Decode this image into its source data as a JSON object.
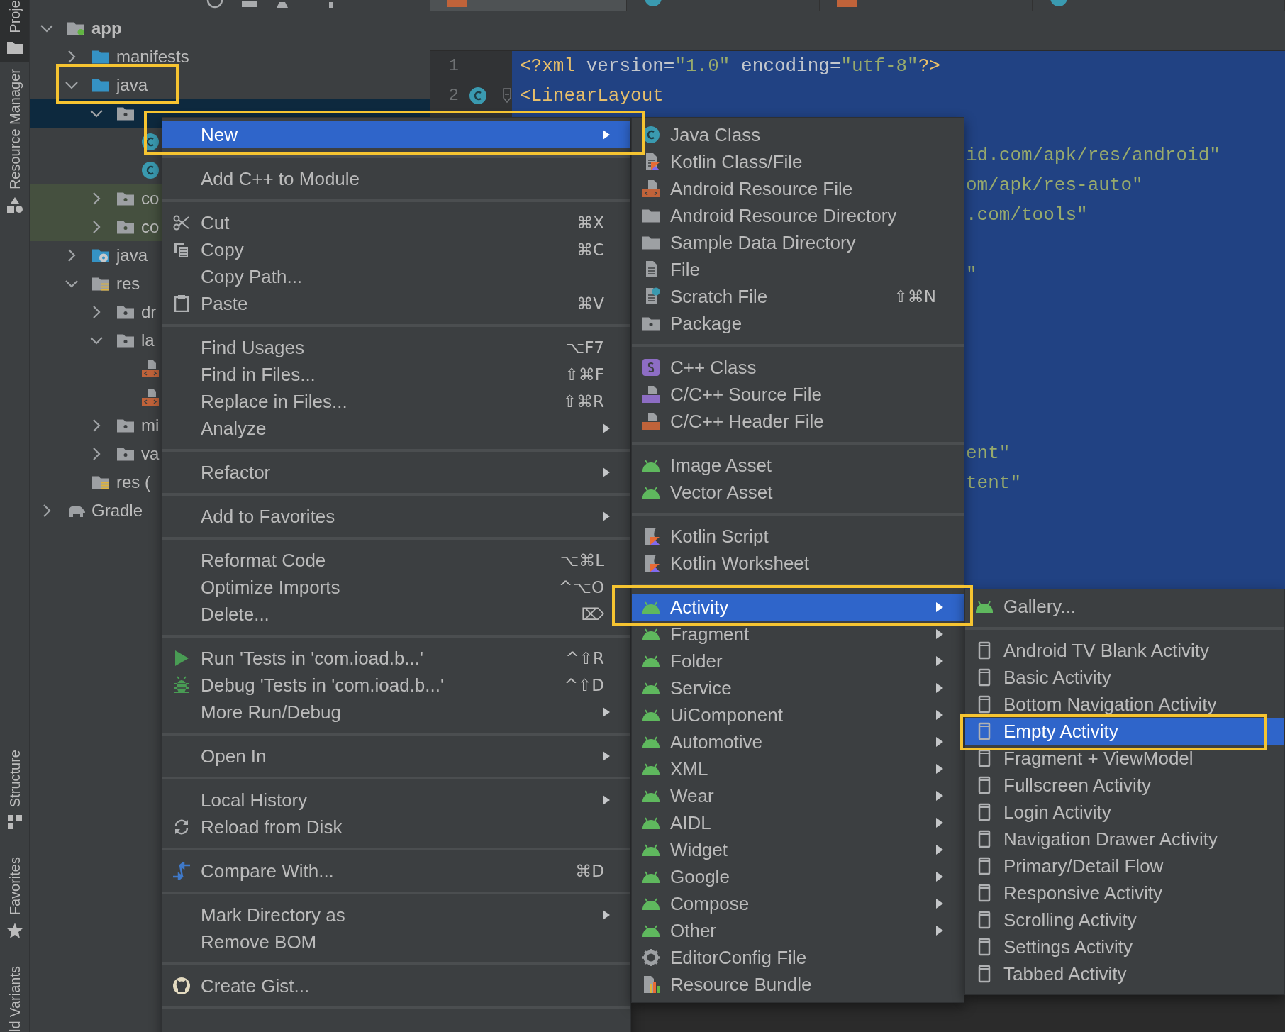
{
  "tool_strip": {
    "top": [
      {
        "label": "Proje",
        "selected": true
      },
      {
        "label": "Resource Manager",
        "selected": false
      }
    ],
    "bottom": [
      {
        "label": "Structure",
        "selected": false
      },
      {
        "label": "Favorites",
        "selected": false
      },
      {
        "label": "ld Variants",
        "selected": false
      }
    ]
  },
  "project_tree": [
    {
      "label": "app",
      "kind": "module",
      "expanded": true,
      "selected": false,
      "children": [
        {
          "label": "manifests",
          "kind": "source-folder",
          "expanded": false,
          "selected": false
        },
        {
          "label": "java",
          "kind": "source-folder",
          "expanded": true,
          "selected": false,
          "boxed": true,
          "children": [
            {
              "kind": "package",
              "expanded": true,
              "selected": true,
              "children": [
                {
                  "kind": "class",
                  "selected": false
                },
                {
                  "kind": "class",
                  "selected": false
                }
              ]
            },
            {
              "label": "co",
              "kind": "test-package",
              "expanded": false,
              "selected": false
            },
            {
              "label": "co",
              "kind": "test-package",
              "expanded": false,
              "selected": false
            }
          ]
        },
        {
          "label": "java",
          "kind": "generated-folder",
          "expanded": false,
          "selected": false
        },
        {
          "label": "res",
          "kind": "res-folder",
          "expanded": true,
          "selected": false,
          "children": [
            {
              "label": "dr",
              "kind": "package",
              "expanded": false,
              "selected": false
            },
            {
              "label": "la",
              "kind": "package",
              "expanded": true,
              "selected": false,
              "children": [
                {
                  "kind": "layout-file",
                  "selected": false
                },
                {
                  "kind": "layout-file",
                  "selected": false
                }
              ]
            },
            {
              "label": "mi",
              "kind": "package",
              "expanded": false,
              "selected": false
            },
            {
              "label": "va",
              "kind": "package",
              "expanded": false,
              "selected": false
            }
          ]
        },
        {
          "label": "res (",
          "kind": "res-folder",
          "selected": false
        }
      ]
    },
    {
      "label": "Gradle",
      "kind": "gradle",
      "expanded": false,
      "selected": false
    }
  ],
  "editor_tabs": [
    {
      "kind": "xml",
      "selected": true
    },
    {
      "kind": "class",
      "selected": false
    },
    {
      "kind": "xml",
      "selected": false
    },
    {
      "kind": "class",
      "selected": false
    }
  ],
  "editor": {
    "lines": [
      {
        "kind": "line",
        "number": "1",
        "fold": false,
        "segments": [
          {
            "text": "<?xml ",
            "kind": "tag"
          },
          {
            "text": "version=",
            "kind": "plain"
          },
          {
            "text": "\"1.0\"",
            "kind": "value"
          },
          {
            "text": " encoding=",
            "kind": "plain"
          },
          {
            "text": "\"utf-8\"",
            "kind": "value"
          },
          {
            "text": "?>",
            "kind": "tag"
          }
        ]
      },
      {
        "kind": "class-line",
        "number": "2",
        "fold": true,
        "segments": [
          {
            "text": "<LinearLayout",
            "kind": "tag"
          }
        ]
      },
      {
        "kind": "covered"
      },
      {
        "kind": "tail",
        "segments": [
          {
            "text": "id.com/apk/res/android\"",
            "kind": "value"
          }
        ]
      },
      {
        "kind": "tail",
        "segments": [
          {
            "text": "om/apk/res-auto\"",
            "kind": "value"
          }
        ]
      },
      {
        "kind": "tail",
        "segments": [
          {
            "text": ".com/tools\"",
            "kind": "value"
          }
        ]
      },
      {
        "kind": "covered"
      },
      {
        "kind": "tail",
        "segments": [
          {
            "text": "\"",
            "kind": "value"
          }
        ]
      },
      {
        "kind": "covered"
      },
      {
        "kind": "covered"
      },
      {
        "kind": "covered"
      },
      {
        "kind": "covered"
      },
      {
        "kind": "covered"
      },
      {
        "kind": "tail",
        "segments": [
          {
            "text": "ent\"",
            "kind": "value"
          }
        ]
      },
      {
        "kind": "tail",
        "segments": [
          {
            "text": "tent\"",
            "kind": "value"
          }
        ]
      }
    ]
  },
  "context_menu": [
    {
      "kind": "plain",
      "label": "New",
      "submenu": true,
      "selected": true,
      "boxed": true
    },
    {
      "kind": "separator"
    },
    {
      "kind": "plain",
      "label": "Add C++ to Module",
      "selected": false
    },
    {
      "kind": "separator"
    },
    {
      "kind": "scissors",
      "label": "Cut",
      "shortcut": "⌘X",
      "selected": false
    },
    {
      "kind": "copy",
      "label": "Copy",
      "shortcut": "⌘C",
      "selected": false
    },
    {
      "kind": "plain",
      "label": "Copy Path...",
      "selected": false
    },
    {
      "kind": "paste",
      "label": "Paste",
      "shortcut": "⌘V",
      "selected": false
    },
    {
      "kind": "separator"
    },
    {
      "kind": "plain",
      "label": "Find Usages",
      "shortcut": "⌥F7",
      "selected": false
    },
    {
      "kind": "plain",
      "label": "Find in Files...",
      "shortcut": "⇧⌘F",
      "selected": false
    },
    {
      "kind": "plain",
      "label": "Replace in Files...",
      "shortcut": "⇧⌘R",
      "selected": false
    },
    {
      "kind": "plain",
      "label": "Analyze",
      "submenu": true,
      "selected": false
    },
    {
      "kind": "separator"
    },
    {
      "kind": "plain",
      "label": "Refactor",
      "submenu": true,
      "selected": false
    },
    {
      "kind": "separator"
    },
    {
      "kind": "plain",
      "label": "Add to Favorites",
      "submenu": true,
      "selected": false
    },
    {
      "kind": "separator"
    },
    {
      "kind": "plain",
      "label": "Reformat Code",
      "shortcut": "⌥⌘L",
      "selected": false
    },
    {
      "kind": "plain",
      "label": "Optimize Imports",
      "shortcut": "^⌥O",
      "selected": false
    },
    {
      "kind": "plain",
      "label": "Delete...",
      "shortcut": "⌦",
      "selected": false
    },
    {
      "kind": "separator"
    },
    {
      "kind": "run",
      "label": "Run 'Tests in 'com.ioad.b...'",
      "shortcut": "^⇧R",
      "selected": false
    },
    {
      "kind": "debug",
      "label": "Debug 'Tests in 'com.ioad.b...'",
      "shortcut": "^⇧D",
      "selected": false
    },
    {
      "kind": "plain",
      "label": "More Run/Debug",
      "submenu": true,
      "selected": false
    },
    {
      "kind": "separator"
    },
    {
      "kind": "plain",
      "label": "Open In",
      "submenu": true,
      "selected": false
    },
    {
      "kind": "separator"
    },
    {
      "kind": "plain",
      "label": "Local History",
      "submenu": true,
      "selected": false
    },
    {
      "kind": "reload",
      "label": "Reload from Disk",
      "selected": false
    },
    {
      "kind": "separator"
    },
    {
      "kind": "compare",
      "label": "Compare With...",
      "shortcut": "⌘D",
      "selected": false
    },
    {
      "kind": "separator"
    },
    {
      "kind": "plain",
      "label": "Mark Directory as",
      "submenu": true,
      "selected": false
    },
    {
      "kind": "plain",
      "label": "Remove BOM",
      "selected": false
    },
    {
      "kind": "separator"
    },
    {
      "kind": "gist",
      "label": "Create Gist...",
      "selected": false
    },
    {
      "kind": "separator"
    }
  ],
  "new_submenu": [
    {
      "kind": "class",
      "label": "Java Class",
      "selected": false
    },
    {
      "kind": "kotlin-file",
      "label": "Kotlin Class/File",
      "selected": false
    },
    {
      "kind": "resource-file",
      "label": "Android Resource File",
      "selected": false
    },
    {
      "kind": "folder",
      "label": "Android Resource Directory",
      "selected": false
    },
    {
      "kind": "folder",
      "label": "Sample Data Directory",
      "selected": false
    },
    {
      "kind": "file",
      "label": "File",
      "selected": false
    },
    {
      "kind": "scratch",
      "label": "Scratch File",
      "shortcut": "⇧⌘N",
      "selected": false
    },
    {
      "kind": "package",
      "label": "Package",
      "selected": false
    },
    {
      "kind": "separator"
    },
    {
      "kind": "cpp-class",
      "label": "C++ Class",
      "selected": false
    },
    {
      "kind": "cpp-source",
      "label": "C/C++ Source File",
      "selected": false
    },
    {
      "kind": "cpp-header",
      "label": "C/C++ Header File",
      "selected": false
    },
    {
      "kind": "separator"
    },
    {
      "kind": "android",
      "label": "Image Asset",
      "selected": false
    },
    {
      "kind": "android",
      "label": "Vector Asset",
      "selected": false
    },
    {
      "kind": "separator"
    },
    {
      "kind": "kotlin-script",
      "label": "Kotlin Script",
      "selected": false
    },
    {
      "kind": "kotlin-script",
      "label": "Kotlin Worksheet",
      "selected": false
    },
    {
      "kind": "separator"
    },
    {
      "kind": "android",
      "label": "Activity",
      "submenu": true,
      "selected": true,
      "boxed": true
    },
    {
      "kind": "android",
      "label": "Fragment",
      "submenu": true,
      "selected": false
    },
    {
      "kind": "android",
      "label": "Folder",
      "submenu": true,
      "selected": false
    },
    {
      "kind": "android",
      "label": "Service",
      "submenu": true,
      "selected": false
    },
    {
      "kind": "android",
      "label": "UiComponent",
      "submenu": true,
      "selected": false
    },
    {
      "kind": "android",
      "label": "Automotive",
      "submenu": true,
      "selected": false
    },
    {
      "kind": "android",
      "label": "XML",
      "submenu": true,
      "selected": false
    },
    {
      "kind": "android",
      "label": "Wear",
      "submenu": true,
      "selected": false
    },
    {
      "kind": "android",
      "label": "AIDL",
      "submenu": true,
      "selected": false
    },
    {
      "kind": "android",
      "label": "Widget",
      "submenu": true,
      "selected": false
    },
    {
      "kind": "android",
      "label": "Google",
      "submenu": true,
      "selected": false
    },
    {
      "kind": "android",
      "label": "Compose",
      "submenu": true,
      "selected": false
    },
    {
      "kind": "android",
      "label": "Other",
      "submenu": true,
      "selected": false
    },
    {
      "kind": "gear",
      "label": "EditorConfig File",
      "selected": false
    },
    {
      "kind": "bundle",
      "label": "Resource Bundle",
      "selected": false
    }
  ],
  "activity_submenu": [
    {
      "kind": "android",
      "label": "Gallery...",
      "selected": false
    },
    {
      "kind": "separator"
    },
    {
      "kind": "phone",
      "label": "Android TV Blank Activity",
      "selected": false
    },
    {
      "kind": "phone",
      "label": "Basic Activity",
      "selected": false
    },
    {
      "kind": "phone",
      "label": "Bottom Navigation Activity",
      "selected": false
    },
    {
      "kind": "phone",
      "label": "Empty Activity",
      "selected": true,
      "boxed": true
    },
    {
      "kind": "phone",
      "label": "Fragment + ViewModel",
      "selected": false
    },
    {
      "kind": "phone",
      "label": "Fullscreen Activity",
      "selected": false
    },
    {
      "kind": "phone",
      "label": "Login Activity",
      "selected": false
    },
    {
      "kind": "phone",
      "label": "Navigation Drawer Activity",
      "selected": false
    },
    {
      "kind": "phone",
      "label": "Primary/Detail Flow",
      "selected": false
    },
    {
      "kind": "phone",
      "label": "Responsive Activity",
      "selected": false
    },
    {
      "kind": "phone",
      "label": "Scrolling Activity",
      "selected": false
    },
    {
      "kind": "phone",
      "label": "Settings Activity",
      "selected": false
    },
    {
      "kind": "phone",
      "label": "Tabbed Activity",
      "selected": false
    }
  ]
}
